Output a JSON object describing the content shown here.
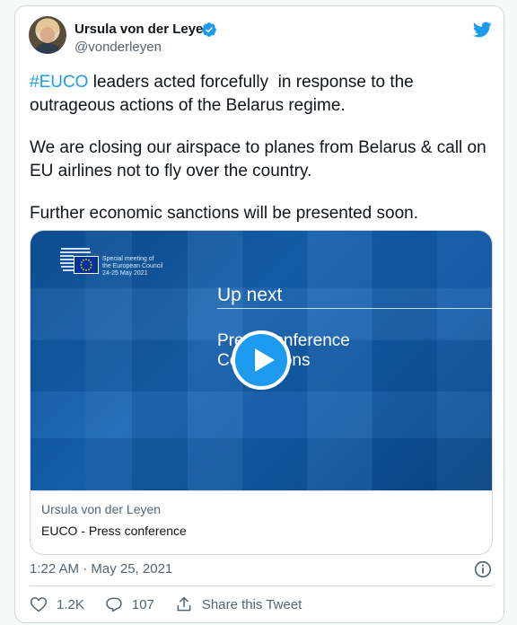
{
  "author": {
    "name": "Ursula von der Leyen",
    "handle": "@vonderleyen",
    "verified_icon": "verified-badge-icon",
    "avatar": "avatar"
  },
  "brand": {
    "icon": "twitter-bird-icon",
    "color": "#1d9bf0"
  },
  "tweet": {
    "hashtag": "#EUCO",
    "line1_rest": " leaders acted forcefully  in response to the outrageous actions of the Belarus regime.",
    "paragraph2": "We are closing our airspace to planes from Belarus & call on EU airlines not to fly over the country.",
    "paragraph3": "Further economic sanctions will be presented soon."
  },
  "media": {
    "logo_text_line1": "Special meeting of",
    "logo_text_line2": "the European Council",
    "logo_text_line3": "24-25 May 2021",
    "up_next": "Up next",
    "video_title_line1": "Press conference",
    "video_title_line2": "Conclusions",
    "play_icon": "play-icon",
    "meta_author": "Ursula von der Leyen",
    "meta_title": "EUCO - Press conference"
  },
  "footer": {
    "timestamp": "1:22 AM · May 25, 2021",
    "info_icon": "info-icon",
    "likes": "1.2K",
    "replies": "107",
    "share_label": "Share this Tweet"
  },
  "colors": {
    "accent": "#1d9bf0",
    "text": "#0f1419",
    "secondary_text": "#536471",
    "border": "#cfd9de"
  }
}
